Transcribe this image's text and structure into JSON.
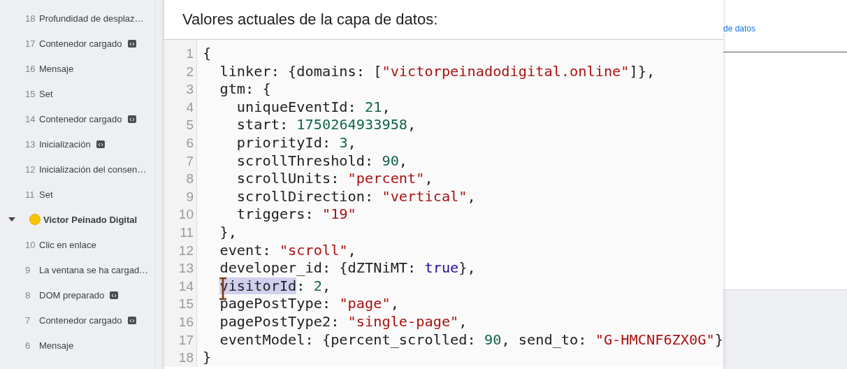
{
  "sidebar": {
    "items": [
      {
        "kind": "event",
        "number": "18",
        "label": "Profundidad de desplaz…",
        "tag_icon": false
      },
      {
        "kind": "event",
        "number": "17",
        "label": "Contenedor cargado",
        "tag_icon": true
      },
      {
        "kind": "event",
        "number": "16",
        "label": "Mensaje",
        "tag_icon": false
      },
      {
        "kind": "event",
        "number": "15",
        "label": "Set",
        "tag_icon": false
      },
      {
        "kind": "event",
        "number": "14",
        "label": "Contenedor cargado",
        "tag_icon": true
      },
      {
        "kind": "event",
        "number": "13",
        "label": "Inicialización",
        "tag_icon": true
      },
      {
        "kind": "event",
        "number": "12",
        "label": "Inicialización del consen…",
        "tag_icon": false
      },
      {
        "kind": "event",
        "number": "11",
        "label": "Set",
        "tag_icon": false
      },
      {
        "kind": "group",
        "label": "Victor Peinado Digital",
        "expanded": true,
        "color": "#f8c400"
      },
      {
        "kind": "event",
        "number": "10",
        "label": "Clic en enlace",
        "tag_icon": false
      },
      {
        "kind": "event",
        "number": "9",
        "label": "La ventana se ha cargad…",
        "tag_icon": false
      },
      {
        "kind": "event",
        "number": "8",
        "label": "DOM preparado",
        "tag_icon": true
      },
      {
        "kind": "event",
        "number": "7",
        "label": "Contenedor cargado",
        "tag_icon": true
      },
      {
        "kind": "event",
        "number": "6",
        "label": "Mensaje",
        "tag_icon": false
      }
    ]
  },
  "panel": {
    "title": "Valores actuales de la capa de datos:",
    "code": {
      "lines": [
        {
          "number": "1",
          "tokens": [
            {
              "text": "{",
              "kind": "plain"
            }
          ]
        },
        {
          "number": "2",
          "tokens": [
            {
              "text": "  linker: {domains: [",
              "kind": "plain"
            },
            {
              "text": "\"victorpeinadodigital.online\"",
              "kind": "string"
            },
            {
              "text": "]},",
              "kind": "plain"
            }
          ]
        },
        {
          "number": "3",
          "tokens": [
            {
              "text": "  gtm: {",
              "kind": "plain"
            }
          ]
        },
        {
          "number": "4",
          "tokens": [
            {
              "text": "    uniqueEventId: ",
              "kind": "plain"
            },
            {
              "text": "21",
              "kind": "number"
            },
            {
              "text": ",",
              "kind": "plain"
            }
          ]
        },
        {
          "number": "5",
          "tokens": [
            {
              "text": "    start: ",
              "kind": "plain"
            },
            {
              "text": "1750264933958",
              "kind": "number"
            },
            {
              "text": ",",
              "kind": "plain"
            }
          ]
        },
        {
          "number": "6",
          "tokens": [
            {
              "text": "    priorityId: ",
              "kind": "plain"
            },
            {
              "text": "3",
              "kind": "number"
            },
            {
              "text": ",",
              "kind": "plain"
            }
          ]
        },
        {
          "number": "7",
          "tokens": [
            {
              "text": "    scrollThreshold: ",
              "kind": "plain"
            },
            {
              "text": "90",
              "kind": "number"
            },
            {
              "text": ",",
              "kind": "plain"
            }
          ]
        },
        {
          "number": "8",
          "tokens": [
            {
              "text": "    scrollUnits: ",
              "kind": "plain"
            },
            {
              "text": "\"percent\"",
              "kind": "string"
            },
            {
              "text": ",",
              "kind": "plain"
            }
          ]
        },
        {
          "number": "9",
          "tokens": [
            {
              "text": "    scrollDirection: ",
              "kind": "plain"
            },
            {
              "text": "\"vertical\"",
              "kind": "string"
            },
            {
              "text": ",",
              "kind": "plain"
            }
          ]
        },
        {
          "number": "10",
          "tokens": [
            {
              "text": "    triggers: ",
              "kind": "plain"
            },
            {
              "text": "\"19\"",
              "kind": "string"
            }
          ]
        },
        {
          "number": "11",
          "tokens": [
            {
              "text": "  },",
              "kind": "plain"
            }
          ]
        },
        {
          "number": "12",
          "tokens": [
            {
              "text": "  event: ",
              "kind": "plain"
            },
            {
              "text": "\"scroll\"",
              "kind": "string"
            },
            {
              "text": ",",
              "kind": "plain"
            }
          ]
        },
        {
          "number": "13",
          "tokens": [
            {
              "text": "  developer_id: {dZTNiMT: ",
              "kind": "plain"
            },
            {
              "text": "true",
              "kind": "boolean"
            },
            {
              "text": "},",
              "kind": "plain"
            }
          ]
        },
        {
          "number": "14",
          "tokens": [
            {
              "text": "  visitorId",
              "kind": "selection"
            },
            {
              "text": ": ",
              "kind": "plain"
            },
            {
              "text": "2",
              "kind": "number"
            },
            {
              "text": ",",
              "kind": "plain"
            }
          ]
        },
        {
          "number": "15",
          "tokens": [
            {
              "text": "  pagePostType: ",
              "kind": "plain"
            },
            {
              "text": "\"page\"",
              "kind": "string"
            },
            {
              "text": ",",
              "kind": "plain"
            }
          ]
        },
        {
          "number": "16",
          "tokens": [
            {
              "text": "  pagePostType2: ",
              "kind": "plain"
            },
            {
              "text": "\"single-page\"",
              "kind": "string"
            },
            {
              "text": ",",
              "kind": "plain"
            }
          ]
        },
        {
          "number": "17",
          "tokens": [
            {
              "text": "  eventModel: {percent_scrolled: ",
              "kind": "plain"
            },
            {
              "text": "90",
              "kind": "number"
            },
            {
              "text": ", send_to: ",
              "kind": "plain"
            },
            {
              "text": "\"G-HMCNF6ZX0G\"",
              "kind": "string"
            },
            {
              "text": "}",
              "kind": "plain"
            }
          ]
        },
        {
          "number": "18",
          "tokens": [
            {
              "text": "}",
              "kind": "plain"
            }
          ]
        }
      ]
    }
  },
  "right": {
    "link": "de datos"
  }
}
